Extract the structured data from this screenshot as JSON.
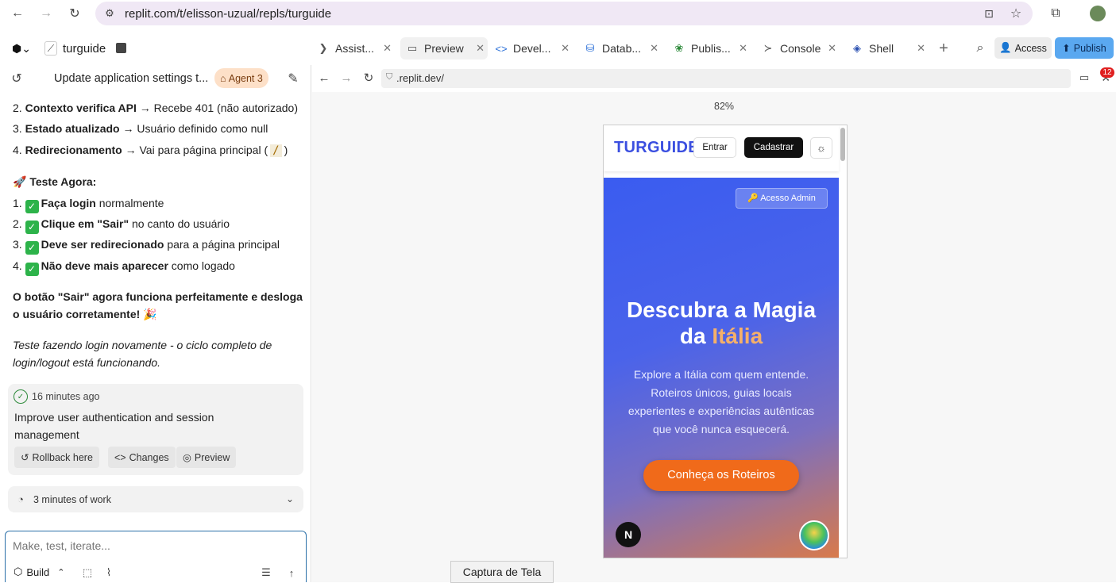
{
  "browser": {
    "url": "replit.com/t/elisson-uzual/repls/turguide"
  },
  "replit": {
    "project_name": "turguide",
    "tabs": [
      {
        "label": "Assist..."
      },
      {
        "label": "Preview"
      },
      {
        "label": "Devel..."
      },
      {
        "label": "Datab..."
      },
      {
        "label": "Publis..."
      },
      {
        "label": "Console"
      },
      {
        "label": "Shell"
      }
    ],
    "access_label": "Access",
    "publish_label": "Publish"
  },
  "chat": {
    "thread_title": "Update application settings t...",
    "agent_badge": "Agent 3",
    "steps": [
      {
        "num": "2.",
        "bold": "Contexto verifica API",
        "rest": " → Recebe 401 (não autorizado)"
      },
      {
        "num": "3.",
        "bold": "Estado atualizado",
        "rest": " → Usuário definido como null"
      },
      {
        "num": "4.",
        "bold": "Redirecionamento",
        "rest": " → Vai para página principal (",
        "code": "/",
        "tail": ")"
      }
    ],
    "test_heading": "🚀 Teste Agora:",
    "tests": [
      {
        "num": "1.",
        "bold": "Faça login",
        "rest": " normalmente"
      },
      {
        "num": "2.",
        "bold": "Clique em \"Sair\"",
        "rest": " no canto do usuário"
      },
      {
        "num": "3.",
        "bold": "Deve ser redirecionado",
        "rest": " para a página principal"
      },
      {
        "num": "4.",
        "bold": "Não deve mais aparecer",
        "rest": " como logado"
      }
    ],
    "summary_line1": "O botão \"Sair\" agora funciona perfeitamente e desloga",
    "summary_line2": "o usuário corretamente! 🎉",
    "italic_line1": "Teste fazendo login novamente - o ciclo completo de",
    "italic_line2": "login/logout está funcionando.",
    "checkpoint": {
      "time": "16 minutes ago",
      "title_line1": "Improve user authentication and session",
      "title_line2": "management",
      "rollback": "Rollback here",
      "changes": "Changes",
      "preview": "Preview"
    },
    "work_summary": "3 minutes of work",
    "input_placeholder": "Make, test, iterate...",
    "build_label": "Build"
  },
  "preview": {
    "address": ".replit.dev/",
    "zoom": "82%",
    "notification_count": "12",
    "site": {
      "logo": "TURGUIDE",
      "login": "Entrar",
      "signup": "Cadastrar",
      "admin": "🔑 Acesso Admin",
      "hero_line1": "Descubra a Magia",
      "hero_da": "da ",
      "hero_highlight": "Itália",
      "desc_line1": "Explore a Itália com quem entende.",
      "desc_line2": "Roteiros únicos, guias locais",
      "desc_line3": "experientes e experiências autênticas",
      "desc_line4": "que você nunca esquecerá.",
      "cta": "Conheça os Roteiros",
      "next_badge": "N"
    }
  },
  "tooltip": "Captura de Tela",
  "colors": {
    "publish_bg": "#5aa8f0",
    "agent_badge_bg": "#fde0c8",
    "logo": "#3b4fe0",
    "cta": "#f06a1a",
    "highlight": "#f5b06a"
  }
}
